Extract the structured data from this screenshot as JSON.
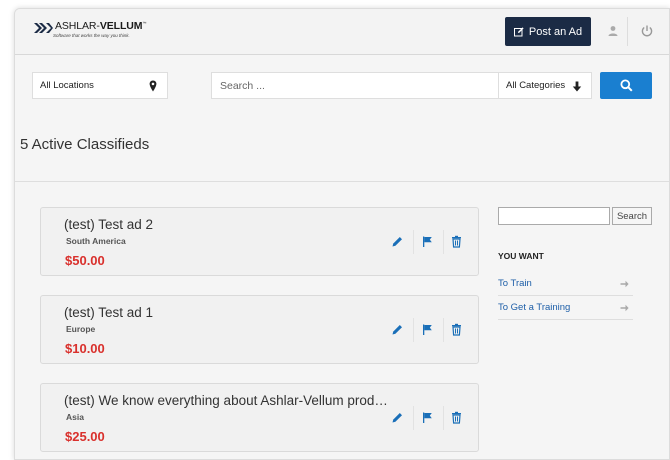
{
  "header": {
    "logo_brand": "ASHLAR",
    "logo_brand2": "VELLUM",
    "logo_tagline": "Software that works the way you think.",
    "post_ad_label": "Post an Ad",
    "user_icon": "user-icon",
    "logout_icon": "power-icon"
  },
  "search": {
    "location_label": "All Locations",
    "search_placeholder": "Search ...",
    "category_label": "All Categories"
  },
  "page_title": "5 Active Classifieds",
  "ads": [
    {
      "title": "(test) Test ad 2",
      "region": "South America",
      "price": "$50.00"
    },
    {
      "title": "(test) Test ad 1",
      "region": "Europe",
      "price": "$10.00"
    },
    {
      "title": "(test) We know everything about Ashlar-Vellum prod…",
      "region": "Asia",
      "price": "$25.00"
    }
  ],
  "sidebar": {
    "search_button": "Search",
    "heading": "YOU WANT",
    "links": [
      {
        "label": "To Train"
      },
      {
        "label": "To Get a Training"
      }
    ]
  },
  "colors": {
    "accent": "#1a7fd0",
    "post_button": "#1b2b45",
    "price": "#d9302c",
    "link": "#1e5fa8"
  }
}
